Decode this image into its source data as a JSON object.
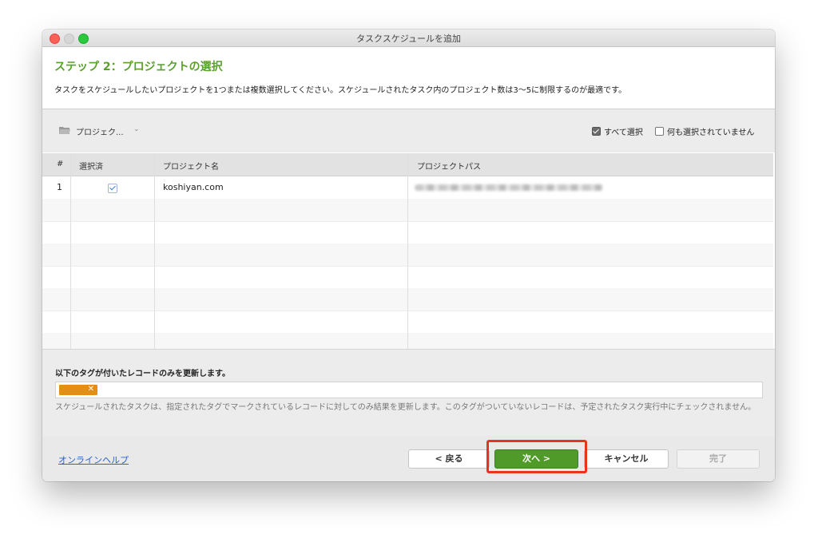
{
  "window": {
    "title": "タスクスケジュールを追加"
  },
  "header": {
    "step_title": "ステップ 2：プロジェクトの選択",
    "description": "タスクをスケジュールしたいプロジェクトを1つまたは複数選択してください。スケジュールされたタスク内のプロジェクト数は3〜5に制限するのが最適です。"
  },
  "toolbar": {
    "project_dropdown": "プロジェク...",
    "select_all_label": "すべて選択",
    "select_none_label": "何も選択されていません",
    "select_all_checked": true,
    "select_none_checked": false
  },
  "table": {
    "columns": [
      "#",
      "選択済",
      "プロジェクト名",
      "プロジェクトパス"
    ],
    "rows": [
      {
        "index": "1",
        "selected": true,
        "name": "koshiyan.com",
        "path_blurred": true
      }
    ]
  },
  "tags": {
    "title": "以下のタグが付いたレコードのみを更新します。",
    "chip_color": "#e58e14",
    "note": "スケジュールされたタスクは、指定されたタグでマークされているレコードに対してのみ結果を更新します。このタグがついていないレコードは、予定されたタスク実行中にチェックされません。"
  },
  "footer": {
    "help_link": "オンラインヘルプ",
    "back_button": "< 戻る",
    "next_button": "次へ >",
    "cancel_button": "キャンセル",
    "finish_button": "完了"
  },
  "colors": {
    "accent_green": "#5aa02c",
    "next_button": "#4f9a28",
    "highlight_red": "#e8341c"
  }
}
